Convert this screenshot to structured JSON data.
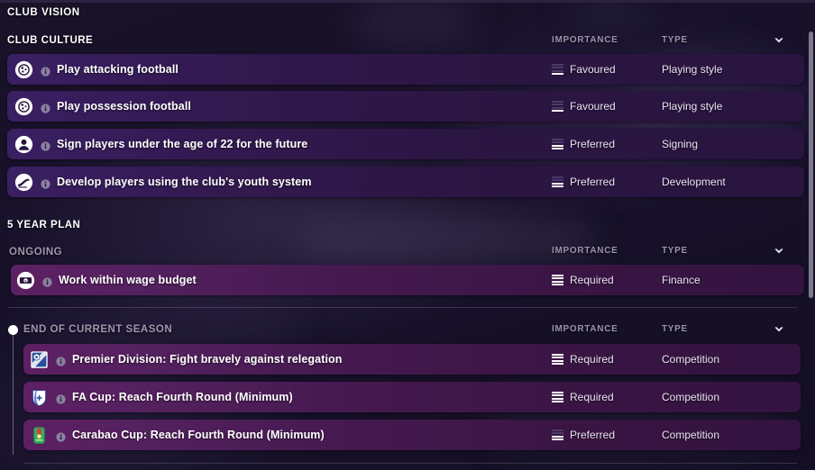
{
  "screen": {
    "title": "CLUB VISION"
  },
  "colors": {
    "accent": "#5d2063",
    "row_culture": "#2f1a4d",
    "row_plan": "#4a1a52",
    "background": "#17112a",
    "header_text": "#9a93ab",
    "text": "#ffffff"
  },
  "icons": {
    "chevron": "chevron-down-icon",
    "info": "info-icon",
    "scrollbar": "scrollbar-thumb"
  },
  "sections": [
    {
      "id": "club-culture",
      "heading": "CLUB CULTURE",
      "columns": {
        "importance": "IMPORTANCE",
        "type": "TYPE"
      },
      "rows": [
        {
          "icon": "football-icon",
          "label": "Play attacking football",
          "importance": "Favoured",
          "importance_level": 1,
          "type": "Playing style"
        },
        {
          "icon": "football-icon",
          "label": "Play possession football",
          "importance": "Favoured",
          "importance_level": 1,
          "type": "Playing style"
        },
        {
          "icon": "player-icon",
          "label": "Sign players under the age of 22 for the future",
          "importance": "Preferred",
          "importance_level": 2,
          "type": "Signing"
        },
        {
          "icon": "boot-icon",
          "label": "Develop players using the club's youth system",
          "importance": "Preferred",
          "importance_level": 2,
          "type": "Development"
        }
      ]
    },
    {
      "id": "five-year-plan",
      "heading": "5 YEAR PLAN",
      "groups": [
        {
          "id": "ongoing",
          "heading": "ONGOING",
          "columns": {
            "importance": "IMPORTANCE",
            "type": "TYPE"
          },
          "rows": [
            {
              "icon": "finance-icon",
              "label": "Work within wage budget",
              "importance": "Required",
              "importance_level": 4,
              "type": "Finance"
            }
          ]
        },
        {
          "id": "end-of-current-season",
          "heading": "END OF CURRENT SEASON",
          "columns": {
            "importance": "IMPORTANCE",
            "type": "TYPE"
          },
          "rows": [
            {
              "icon": "premier-division-badge",
              "label": "Premier Division: Fight bravely against relegation",
              "importance": "Required",
              "importance_level": 4,
              "type": "Competition"
            },
            {
              "icon": "fa-cup-badge",
              "label": "FA Cup: Reach Fourth Round (Minimum)",
              "importance": "Required",
              "importance_level": 4,
              "type": "Competition"
            },
            {
              "icon": "carabao-cup-badge",
              "label": "Carabao Cup: Reach Fourth Round (Minimum)",
              "importance": "Preferred",
              "importance_level": 2,
              "type": "Competition"
            }
          ]
        }
      ]
    }
  ]
}
